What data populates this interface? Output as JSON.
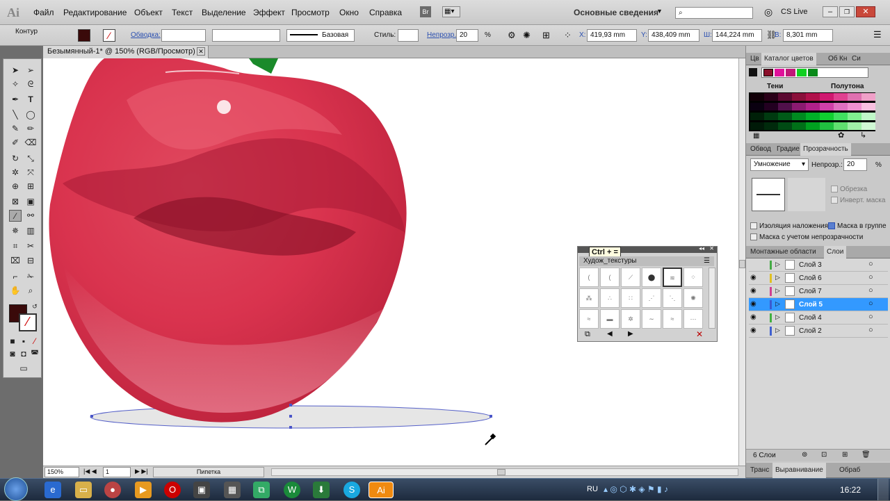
{
  "app": {
    "logo": "Ai"
  },
  "menu": [
    "Файл",
    "Редактирование",
    "Объект",
    "Текст",
    "Выделение",
    "Эффект",
    "Просмотр",
    "Окно",
    "Справка"
  ],
  "menubar_right": {
    "br": "Br",
    "workspace": "Основные сведения",
    "search_placeholder": "",
    "cslive": "CS Live"
  },
  "control": {
    "mode": "Контур",
    "stroke_label": "Обводка:",
    "brush": "Базовая",
    "style_label": "Стиль:",
    "opacity_label": "Непрозр.:",
    "opacity": "20",
    "opacity_unit": "%",
    "x_label": "X:",
    "x": "419,93 mm",
    "y_label": "Y:",
    "y": "438,409 mm",
    "w_label": "Ш:",
    "w": "144,224 mm",
    "h_label": "В:",
    "h": "8,301 mm"
  },
  "document": {
    "tab": "Безымянный-1* @ 150% (RGB/Просмотр)"
  },
  "status": {
    "zoom": "150%",
    "page": "1",
    "tool": "Пипетка"
  },
  "swatch_panel": {
    "tabs": [
      "Цв",
      "Каталог цветов",
      "Об",
      "Кн",
      "Си"
    ],
    "shades_label": "Тени",
    "tints_label": "Полутона"
  },
  "transparency_panel": {
    "tabs": [
      "Обвод",
      "Градие",
      "Прозрачность"
    ],
    "blend": "Умножение",
    "opacity_label": "Непрозр.:",
    "opacity": "20",
    "unit": "%",
    "clip": "Обрезка",
    "invert": "Инверт. маска",
    "isolate": "Изоляция наложения",
    "knockout": "Маска в группе",
    "opacity_mask": "Маска с учетом непрозрачности"
  },
  "layers_panel": {
    "tabs": [
      "Монтажные области",
      "Слои"
    ],
    "layers": [
      "Слой 3",
      "Слой 6",
      "Слой 7",
      "Слой 5",
      "Слой 4",
      "Слой 2"
    ],
    "count": "6 Слои"
  },
  "bottom_tabs": [
    "Транс",
    "Выравнивание",
    "Обраб"
  ],
  "brushes_panel": {
    "tooltip": "Ctrl + =",
    "title": "Худож_текстуры"
  },
  "taskbar": {
    "lang": "RU",
    "time": "16:22"
  },
  "colors": {
    "accent": "#3399ff",
    "fill": "#3a0a0a",
    "selection": "#4a55c8"
  }
}
